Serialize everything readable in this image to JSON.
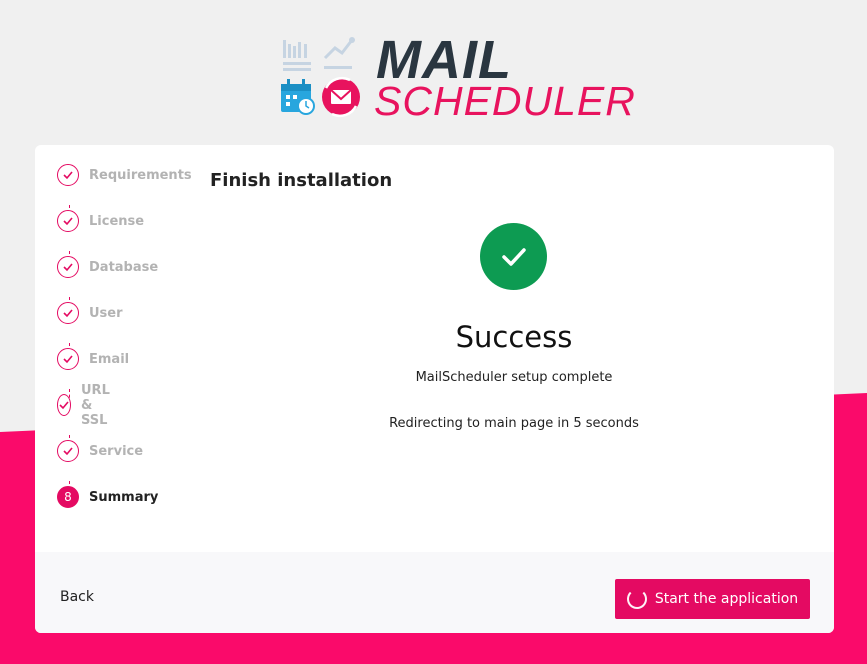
{
  "brand": {
    "title": "MAIL",
    "subtitle": "SCHEDULER",
    "accent_color": "#e40a62",
    "dark_color": "#2a3640"
  },
  "steps": [
    {
      "label": "Requirements",
      "status": "done",
      "icon": "check-icon"
    },
    {
      "label": "License",
      "status": "done",
      "icon": "check-icon"
    },
    {
      "label": "Database",
      "status": "done",
      "icon": "check-icon"
    },
    {
      "label": "User",
      "status": "done",
      "icon": "check-icon"
    },
    {
      "label": "Email",
      "status": "done",
      "icon": "check-icon"
    },
    {
      "label": "URL & SSL",
      "status": "done",
      "icon": "check-icon"
    },
    {
      "label": "Service",
      "status": "done",
      "icon": "check-icon"
    },
    {
      "label": "Summary",
      "status": "active",
      "number": "8"
    }
  ],
  "main": {
    "title": "Finish installation",
    "success_heading": "Success",
    "success_subtitle": "MailScheduler setup complete",
    "redirect_text": "Redirecting to main page in 5 seconds",
    "success_color": "#0d9b52"
  },
  "footer": {
    "back_label": "Back",
    "start_label": "Start the application"
  }
}
